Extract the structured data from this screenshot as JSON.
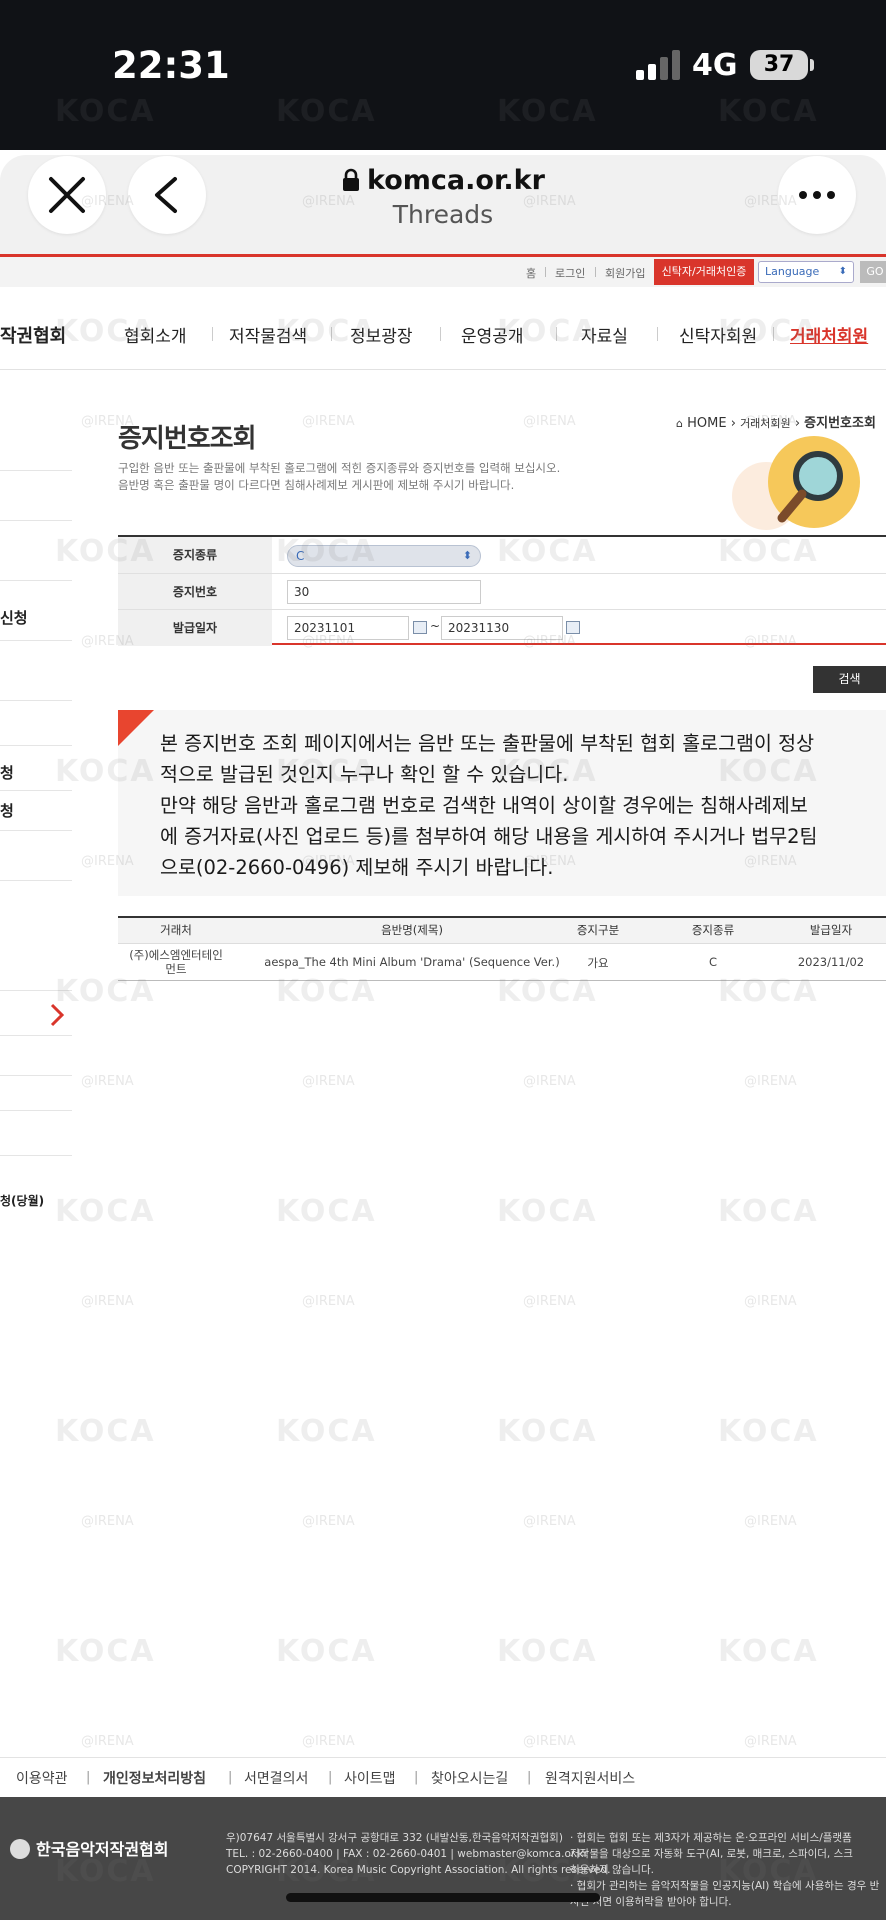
{
  "status_bar": {
    "time": "22:31",
    "network": "4G",
    "battery": "37"
  },
  "browser": {
    "domain": "komca.or.kr",
    "subtitle": "Threads",
    "close_icon": "close-icon",
    "back_icon": "chevron-left-icon",
    "more_icon": "more-icon"
  },
  "util_nav": {
    "items": [
      "홈",
      "로그인",
      "회원가입"
    ],
    "trustee_button": "신탁자/거래처인증",
    "language_select": "Language",
    "go_button": "GO"
  },
  "gnb": {
    "logo_fragment": "작권협회",
    "items": [
      "협회소개",
      "저작물검색",
      "정보광장",
      "운영공개",
      "자료실",
      "신탁자회원",
      "거래처회원"
    ],
    "active_color": "#d9352b"
  },
  "sidebar": {
    "items": [
      "신청",
      "청",
      "청",
      "청(당월)"
    ]
  },
  "page": {
    "title": "증지번호조회",
    "description": [
      "구입한 음반 또는 출판물에 부착된 홀로그램에 적힌 증지종류와 증지번호를 입력해 보십시오.",
      "음반명 혹은 출판물 명이 다르다면 침해사례제보 게시판에 제보해 주시기 바랍니다."
    ],
    "breadcrumb": {
      "home": "HOME",
      "level1": "거래처회원",
      "current": "증지번호조회"
    }
  },
  "search_form": {
    "type_label": "증지종류",
    "type_value": "C",
    "number_label": "증지번호",
    "number_value": "30",
    "date_label": "발급일자",
    "date_from": "20231101",
    "date_sep": "~",
    "date_to": "20231130",
    "search_button": "검색"
  },
  "notice": {
    "lines": [
      "본 증지번호 조회 페이지에서는 음반 또는 출판물에 부착된 협회 홀로그램이 정상",
      "적으로 발급된 것인지 누구나 확인 할 수 있습니다.",
      "만약 해당 음반과 홀로그램 번호로 검색한 내역이 상이할 경우에는 침해사례제보",
      "에 증거자료(사진 업로드 등)를 첨부하여 해당 내용을 게시하여 주시거나 법무2팀",
      "으로(02-2660-0496) 제보해 주시기 바랍니다."
    ]
  },
  "results": {
    "columns": [
      "거래처",
      "음반명(제목)",
      "증지구분",
      "증지종류",
      "발급일자"
    ],
    "rows": [
      {
        "client_line1": "(주)에스엠엔터테인",
        "client_line2": "먼트",
        "title": "aespa_The 4th Mini Album 'Drama' (Sequence Ver.)",
        "category": "가요",
        "type": "C",
        "date": "2023/11/02"
      }
    ]
  },
  "footer_links": [
    "이용약관",
    "개인정보처리방침",
    "서면결의서",
    "사이트맵",
    "찾아오시는길",
    "원격지원서비스"
  ],
  "footer": {
    "logo": "한국음악저작권협회",
    "address_lines": [
      "우)07647 서울특별시 강서구 공항대로 332 (내발산동,한국음악저작권협회)",
      "TEL. : 02-2660-0400 | FAX : 02-2660-0401 | webmaster@komca.or.kr",
      "COPYRIGHT 2014. Korea Music Copyright Association. All rights reserved."
    ],
    "note_lines": [
      "· 협회는 협회 또는 제3자가 제공하는 온·오프라인 서비스/플랫폼",
      "저작물을 대상으로 자동화 도구(AI, 로봇, 매크로, 스파이더, 스크",
      "허용하지 않습니다.",
      "· 협회가 관리하는 음악저작물을 인공지능(AI) 학습에 사용하는 경우 반",
      "사전 서면 이용허락을 받아야 합니다."
    ]
  },
  "watermarks": {
    "logo": "KOCA",
    "handle": "@IRENA"
  }
}
